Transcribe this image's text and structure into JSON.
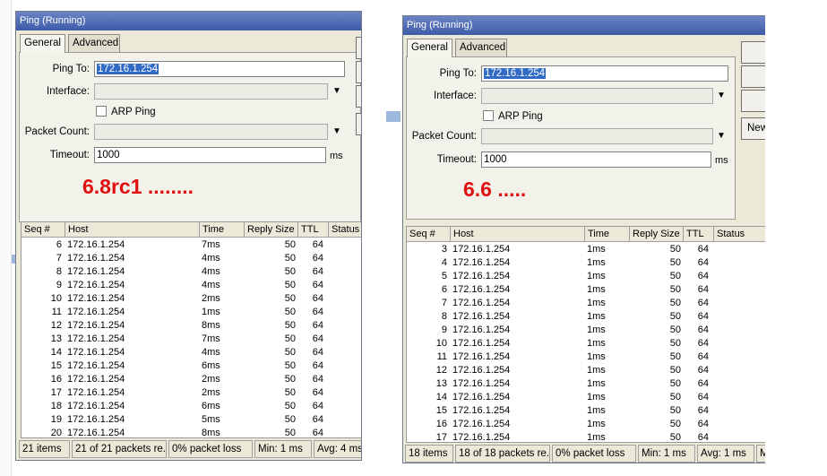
{
  "left": {
    "title": "Ping (Running)",
    "tabs": [
      "General",
      "Advanced"
    ],
    "ping_to_label": "Ping To:",
    "ping_to_value": "172.16.1.254",
    "interface_label": "Interface:",
    "arp_ping_label": "ARP Ping",
    "packet_count_label": "Packet Count:",
    "timeout_label": "Timeout:",
    "timeout_value": "1000",
    "timeout_unit": "ms",
    "version_note": "6.8rc1 ........",
    "columns": [
      "Seq #",
      "Host",
      "Time",
      "Reply Size",
      "TTL",
      "Status"
    ],
    "rows": [
      [
        "6",
        "172.16.1.254",
        "7ms",
        "50",
        "64"
      ],
      [
        "7",
        "172.16.1.254",
        "4ms",
        "50",
        "64"
      ],
      [
        "8",
        "172.16.1.254",
        "4ms",
        "50",
        "64"
      ],
      [
        "9",
        "172.16.1.254",
        "4ms",
        "50",
        "64"
      ],
      [
        "10",
        "172.16.1.254",
        "2ms",
        "50",
        "64"
      ],
      [
        "11",
        "172.16.1.254",
        "1ms",
        "50",
        "64"
      ],
      [
        "12",
        "172.16.1.254",
        "8ms",
        "50",
        "64"
      ],
      [
        "13",
        "172.16.1.254",
        "7ms",
        "50",
        "64"
      ],
      [
        "14",
        "172.16.1.254",
        "4ms",
        "50",
        "64"
      ],
      [
        "15",
        "172.16.1.254",
        "6ms",
        "50",
        "64"
      ],
      [
        "16",
        "172.16.1.254",
        "2ms",
        "50",
        "64"
      ],
      [
        "17",
        "172.16.1.254",
        "2ms",
        "50",
        "64"
      ],
      [
        "18",
        "172.16.1.254",
        "6ms",
        "50",
        "64"
      ],
      [
        "19",
        "172.16.1.254",
        "5ms",
        "50",
        "64"
      ],
      [
        "20",
        "172.16.1.254",
        "8ms",
        "50",
        "64"
      ]
    ],
    "status": {
      "items": "21 items",
      "packets": "21 of 21 packets re...",
      "loss": "0% packet loss",
      "min": "Min: 1 ms",
      "avg": "Avg: 4 ms"
    }
  },
  "right": {
    "title": "Ping (Running)",
    "tabs": [
      "General",
      "Advanced"
    ],
    "ping_to_label": "Ping To:",
    "ping_to_value": "172.16.1.254",
    "interface_label": "Interface:",
    "arp_ping_label": "ARP Ping",
    "packet_count_label": "Packet Count:",
    "timeout_label": "Timeout:",
    "timeout_value": "1000",
    "timeout_unit": "ms",
    "version_note": "6.6 .....",
    "new_button": "New",
    "columns": [
      "Seq #",
      "Host",
      "Time",
      "Reply Size",
      "TTL",
      "Status"
    ],
    "rows": [
      [
        "3",
        "172.16.1.254",
        "1ms",
        "50",
        "64"
      ],
      [
        "4",
        "172.16.1.254",
        "1ms",
        "50",
        "64"
      ],
      [
        "5",
        "172.16.1.254",
        "1ms",
        "50",
        "64"
      ],
      [
        "6",
        "172.16.1.254",
        "1ms",
        "50",
        "64"
      ],
      [
        "7",
        "172.16.1.254",
        "1ms",
        "50",
        "64"
      ],
      [
        "8",
        "172.16.1.254",
        "1ms",
        "50",
        "64"
      ],
      [
        "9",
        "172.16.1.254",
        "1ms",
        "50",
        "64"
      ],
      [
        "10",
        "172.16.1.254",
        "1ms",
        "50",
        "64"
      ],
      [
        "11",
        "172.16.1.254",
        "1ms",
        "50",
        "64"
      ],
      [
        "12",
        "172.16.1.254",
        "1ms",
        "50",
        "64"
      ],
      [
        "13",
        "172.16.1.254",
        "1ms",
        "50",
        "64"
      ],
      [
        "14",
        "172.16.1.254",
        "1ms",
        "50",
        "64"
      ],
      [
        "15",
        "172.16.1.254",
        "1ms",
        "50",
        "64"
      ],
      [
        "16",
        "172.16.1.254",
        "1ms",
        "50",
        "64"
      ],
      [
        "17",
        "172.16.1.254",
        "1ms",
        "50",
        "64"
      ]
    ],
    "status": {
      "items": "18 items",
      "packets": "18 of 18 packets re...",
      "loss": "0% packet loss",
      "min": "Min: 1 ms",
      "avg": "Avg: 1 ms",
      "extra": "M"
    }
  }
}
